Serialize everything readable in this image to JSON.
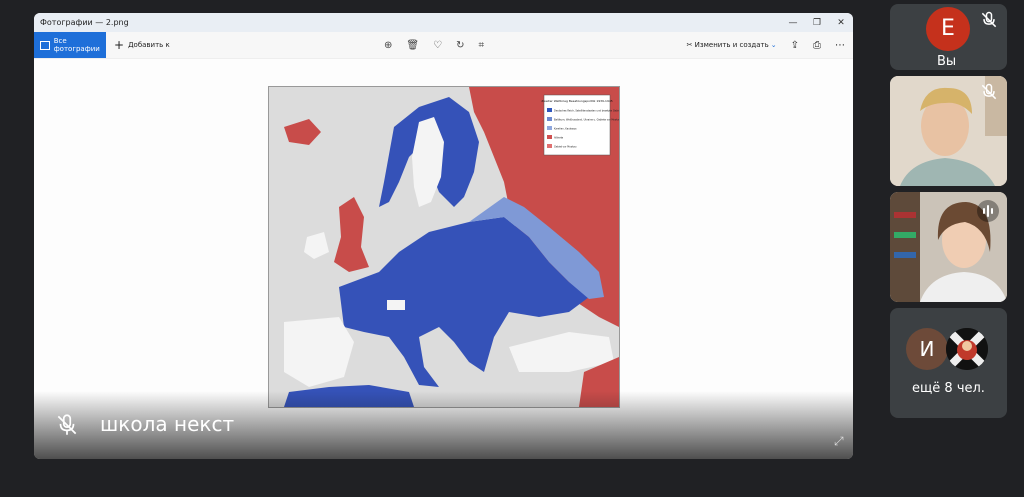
{
  "photos": {
    "window_title": "Фотографии — 2.png",
    "all_photos_label": "Все фотографии",
    "add_label": "Добавить к",
    "edit_label": "Изменить и создать"
  },
  "map": {
    "legend_title": "Zweiter Weltkrieg Besatzungspolitik 1939-1945",
    "legend_items": [
      {
        "color": "#2f56bd",
        "label": "Deutsches Reich, Satellitenstaaten und besetzte Gebiete"
      },
      {
        "color": "#6b88cf",
        "label": "Baltikum, Weißrussland, Ukraine u. Gebiete vor Moskau"
      },
      {
        "color": "#8fa7dd",
        "label": "Karelien, Kaukasus"
      },
      {
        "color": "#d05050",
        "label": "Alliierte"
      },
      {
        "color": "#e07070",
        "label": "Gebiet vor Moskau"
      }
    ],
    "colors": {
      "axis": "#3552b8",
      "axis_light": "#7f99d6",
      "allies": "#c84c4a",
      "neutral": "#f4f4f4",
      "sea": "#dcdcdc"
    }
  },
  "meeting": {
    "presenter_name": "школа некст",
    "you_initial": "E",
    "you_label": "Вы",
    "other_initial": "И",
    "more_label": "ещё 8 чел."
  }
}
